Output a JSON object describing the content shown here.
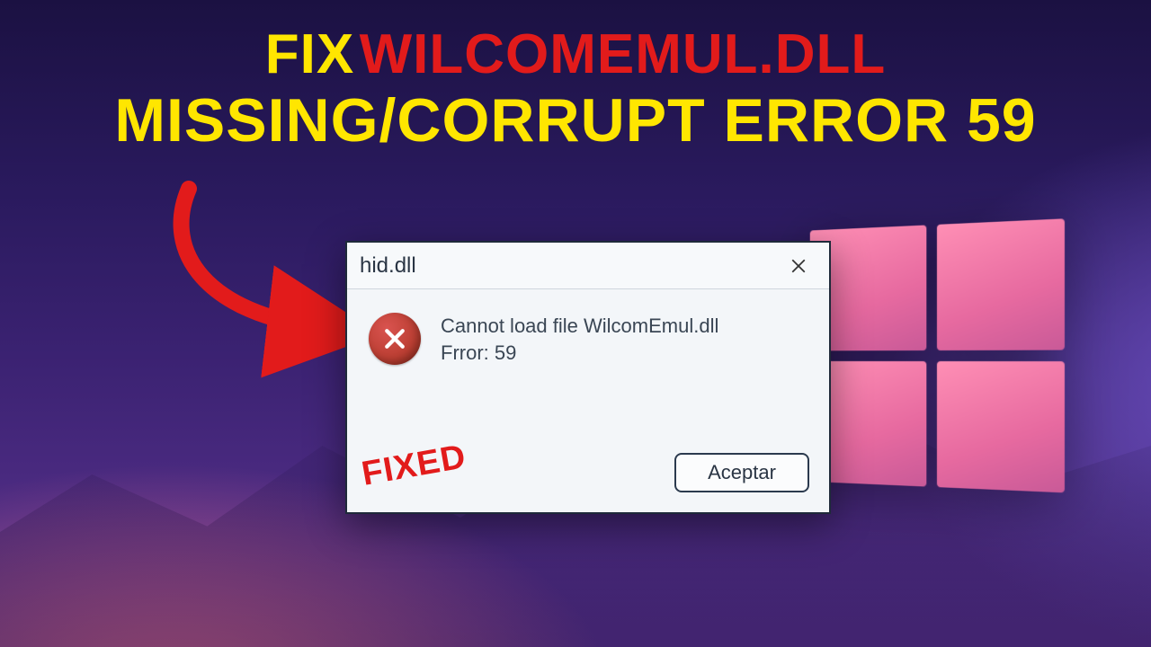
{
  "headline": {
    "fix": "FIX",
    "dll": "WILCOMEMUL.DLL",
    "sub": "MISSING/CORRUPT ERROR 59"
  },
  "dialog": {
    "title": "hid.dll",
    "message_line1": "Cannot load file WilcomEmul.dll",
    "message_line2": "Frror: 59",
    "accept_label": "Aceptar",
    "stamp": "FIXED"
  },
  "icons": {
    "close": "close-icon",
    "error": "error-icon",
    "arrow": "arrow-icon",
    "windows": "windows-logo"
  },
  "colors": {
    "accent_yellow": "#ffe600",
    "accent_red": "#e21b1b",
    "dialog_bg": "#f3f6f9"
  }
}
